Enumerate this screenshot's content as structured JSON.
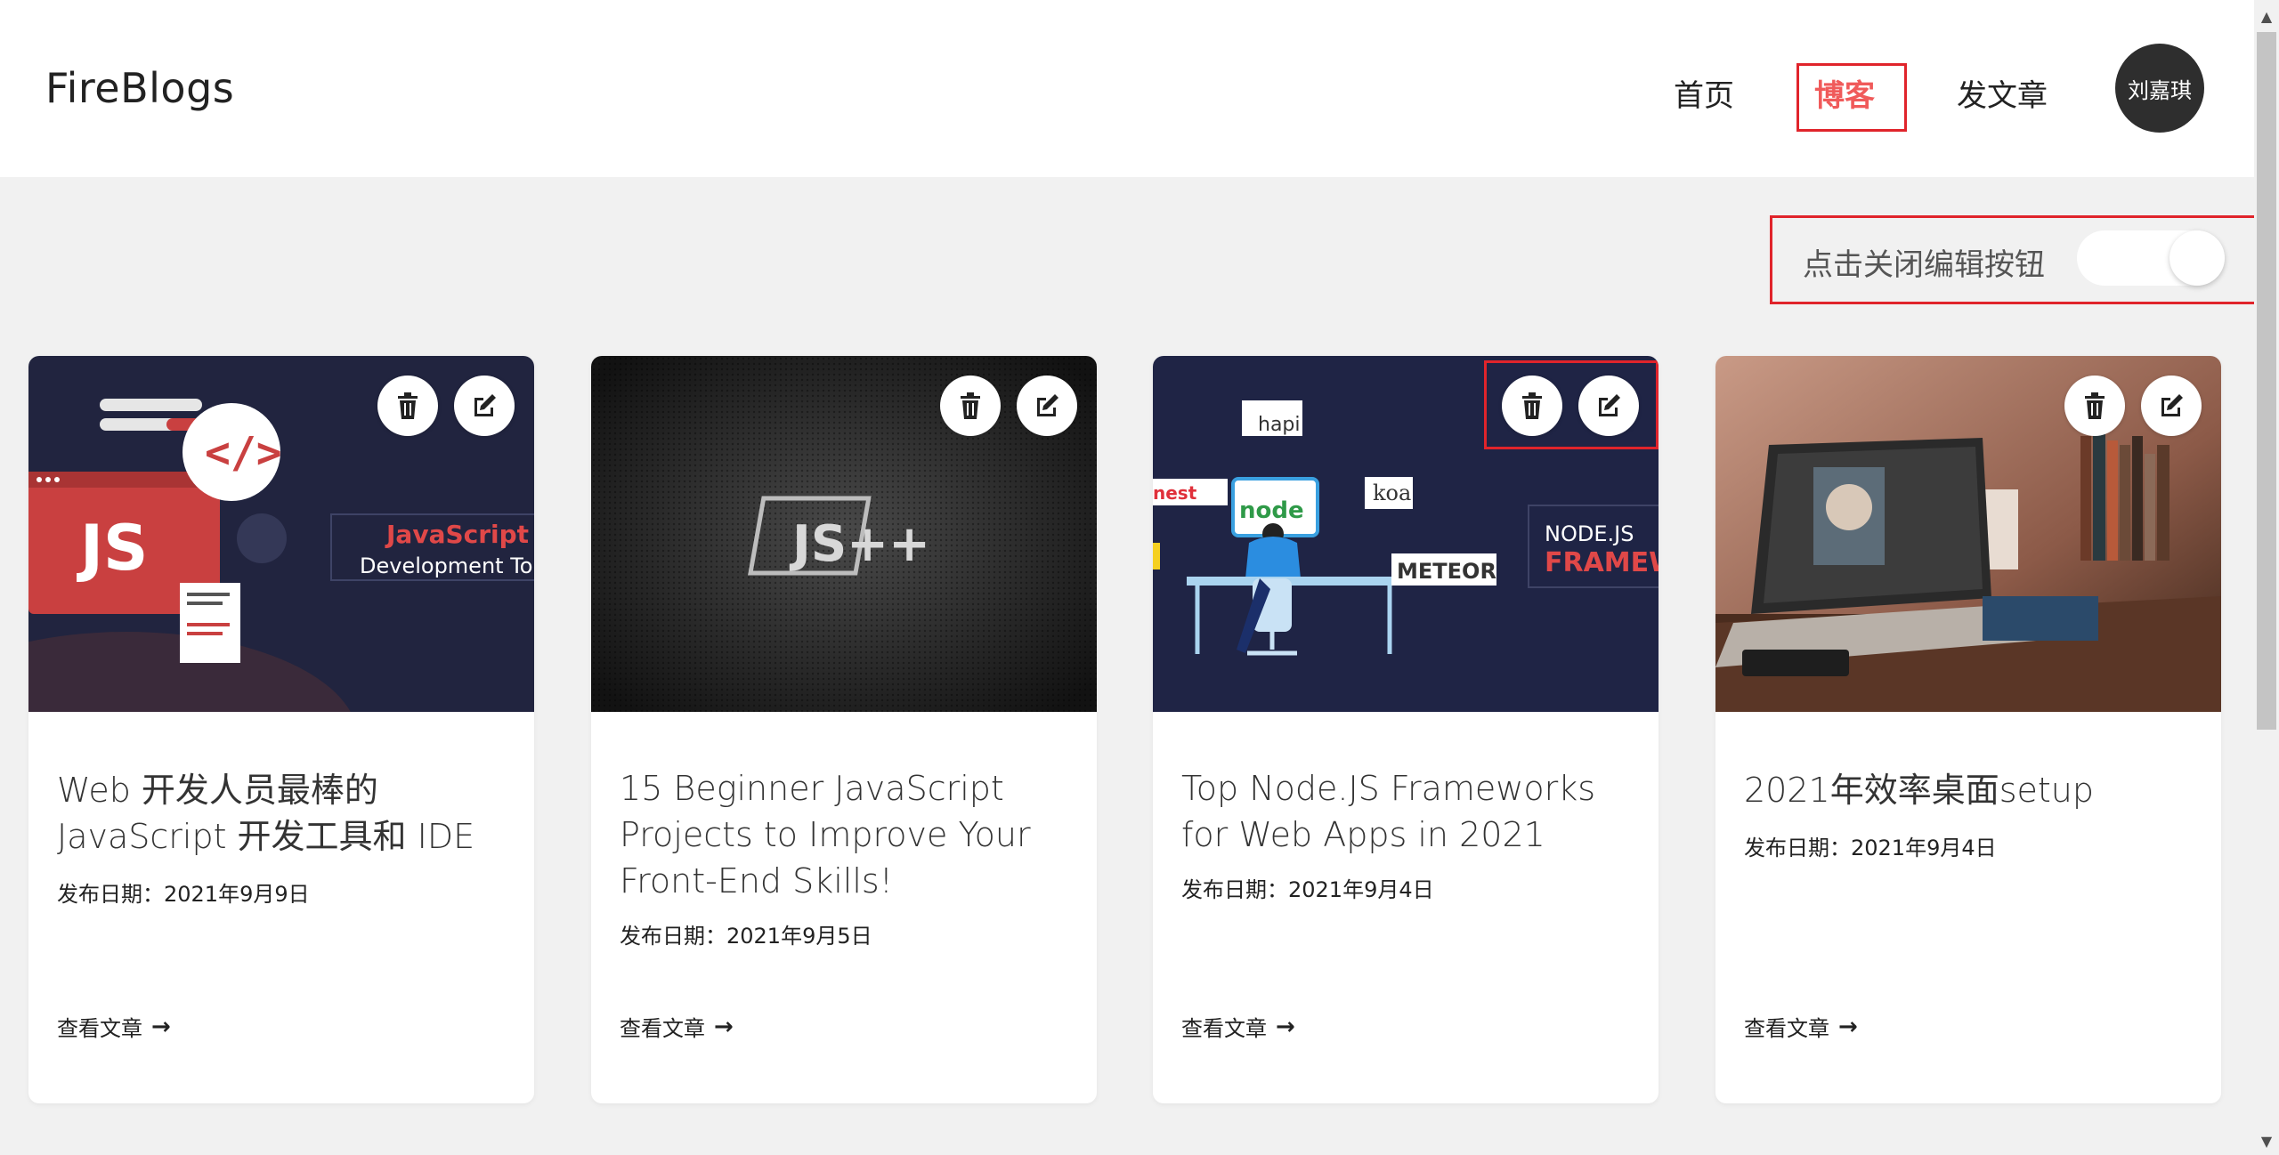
{
  "header": {
    "logo": "FireBlogs",
    "nav": [
      {
        "label": "首页"
      },
      {
        "label": "博客"
      },
      {
        "label": "发文章"
      }
    ],
    "avatar_label": "刘嘉琪"
  },
  "toggle": {
    "label": "点击关闭编辑按钮",
    "checked": true
  },
  "colors": {
    "accent": "#f05a5a",
    "highlight_box": "#e0242b",
    "avatar_bg": "#2e2e2e",
    "page_bg": "#f1f1f1"
  },
  "posts": [
    {
      "title": "Web 开发人员最棒的 JavaScript 开发工具和 IDE",
      "date": "发布日期：2021年9月9日",
      "link_label": "查看文章",
      "image_text": [
        "JS",
        "JavaScript",
        "Development To"
      ],
      "icons": [
        "trash-icon",
        "edit-icon"
      ]
    },
    {
      "title": "15 Beginner JavaScript Projects to Improve Your Front-End Skills!",
      "date": "发布日期：2021年9月5日",
      "link_label": "查看文章",
      "image_text": [
        "JS++"
      ],
      "icons": [
        "trash-icon",
        "edit-icon"
      ]
    },
    {
      "title": "Top Node.JS Frameworks for Web Apps in 2021",
      "date": "发布日期：2021年9月4日",
      "link_label": "查看文章",
      "image_text": [
        "hapi",
        "koa",
        "node",
        "METEOR",
        "NODE.JS",
        "FRAMEW",
        "nest"
      ],
      "icons": [
        "trash-icon",
        "edit-icon"
      ]
    },
    {
      "title": "2021年效率桌面setup",
      "date": "发布日期：2021年9月4日",
      "link_label": "查看文章",
      "image_text": [],
      "icons": [
        "trash-icon",
        "edit-icon"
      ]
    }
  ]
}
